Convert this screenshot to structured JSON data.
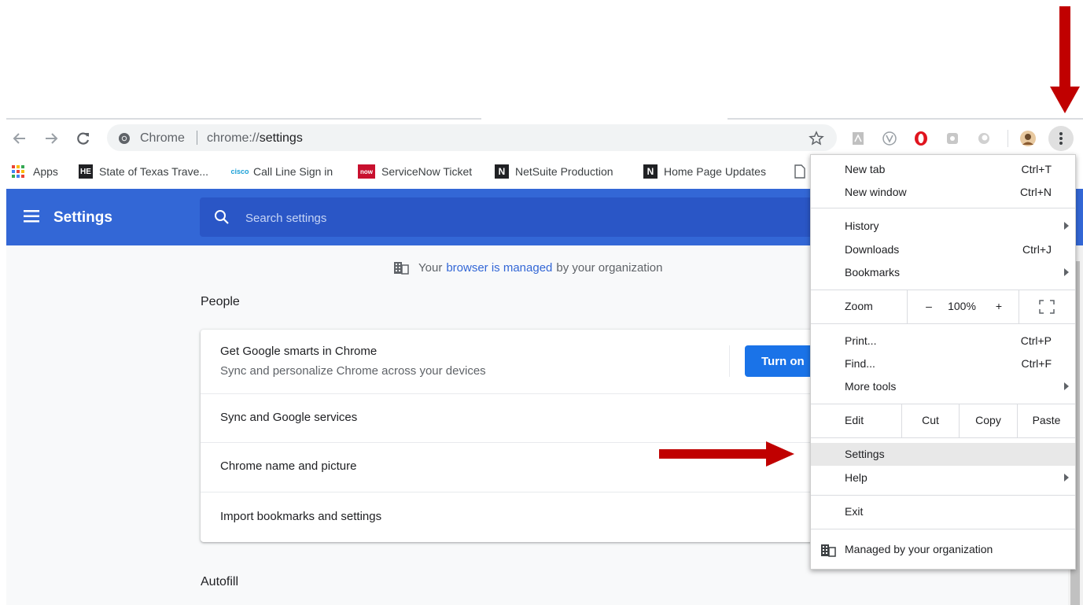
{
  "toolbar": {
    "omnibox_site": "Chrome",
    "omnibox_url_prefix": "chrome://",
    "omnibox_url_path": "settings"
  },
  "bookmarks": [
    {
      "label": "Apps",
      "icon": "apps-grid-icon"
    },
    {
      "label": "State of Texas Trave...",
      "icon": "he-logo-icon"
    },
    {
      "label": "Call Line Sign in",
      "icon": "cisco-logo-icon"
    },
    {
      "label": "ServiceNow Ticket",
      "icon": "servicenow-icon"
    },
    {
      "label": "NetSuite Production",
      "icon": "netsuite-n-icon"
    },
    {
      "label": "Home Page Updates",
      "icon": "netsuite-n-icon"
    }
  ],
  "header": {
    "title": "Settings",
    "search_placeholder": "Search settings"
  },
  "main": {
    "managed_prefix": "Your",
    "managed_link": "browser is managed",
    "managed_suffix": "by your organization",
    "people_title": "People",
    "smarts_title": "Get Google smarts in Chrome",
    "smarts_subtitle": "Sync and personalize Chrome across your devices",
    "turn_on_label": "Turn on",
    "rows": [
      "Sync and Google services",
      "Chrome name and picture",
      "Import bookmarks and settings"
    ],
    "autofill_title": "Autofill"
  },
  "menu": {
    "new_tab": {
      "label": "New tab",
      "shortcut": "Ctrl+T"
    },
    "new_window": {
      "label": "New window",
      "shortcut": "Ctrl+N"
    },
    "history": {
      "label": "History"
    },
    "downloads": {
      "label": "Downloads",
      "shortcut": "Ctrl+J"
    },
    "bookmarks": {
      "label": "Bookmarks"
    },
    "zoom": {
      "label": "Zoom",
      "minus": "–",
      "value": "100%",
      "plus": "+"
    },
    "print": {
      "label": "Print...",
      "shortcut": "Ctrl+P"
    },
    "find": {
      "label": "Find...",
      "shortcut": "Ctrl+F"
    },
    "more_tools": {
      "label": "More tools"
    },
    "edit": {
      "label": "Edit",
      "cut": "Cut",
      "copy": "Copy",
      "paste": "Paste"
    },
    "settings": {
      "label": "Settings"
    },
    "help": {
      "label": "Help"
    },
    "exit": {
      "label": "Exit"
    },
    "managed": {
      "label": "Managed by your organization"
    }
  },
  "colors": {
    "header_blue": "#3367d6",
    "button_blue": "#1a73e8",
    "annotation_red": "#c00000"
  }
}
